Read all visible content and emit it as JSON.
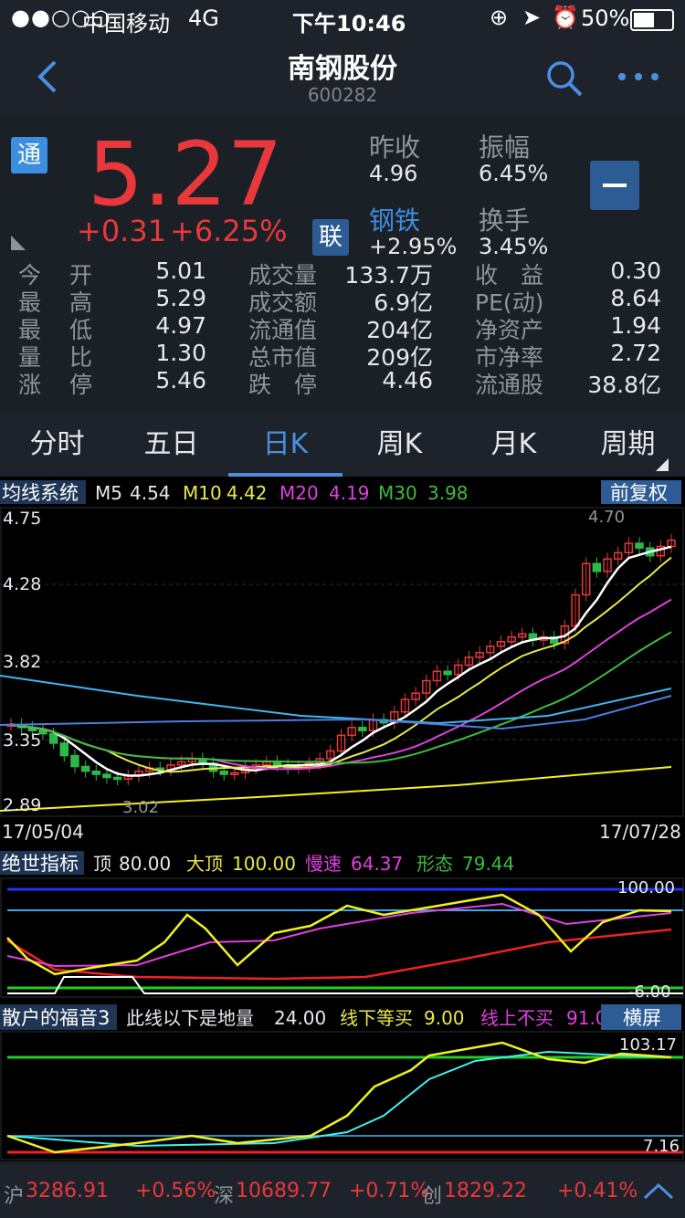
{
  "status": {
    "carrier": "中国移动",
    "network": "4G",
    "time": "下午10:46",
    "battery": "50%"
  },
  "nav": {
    "title": "南钢股份",
    "code": "600282"
  },
  "quote": {
    "tong_badge": "通",
    "lian_badge": "联",
    "price": "5.27",
    "change": "+0.31",
    "change_pct": "+6.25%",
    "prev_close_label": "昨收",
    "prev_close": "4.96",
    "amplitude_label": "振幅",
    "amplitude": "6.45%",
    "sector_label": "钢铁",
    "sector_change": "+2.95%",
    "turnover_label": "换手",
    "turnover": "3.45%",
    "stats": [
      {
        "l1": "今",
        "l2": "开",
        "v1": "5.01",
        "l3": "成交量",
        "v2": "133.7万",
        "l4": "收　益",
        "v3": "0.30"
      },
      {
        "l1": "最",
        "l2": "高",
        "v1": "5.29",
        "l3": "成交额",
        "v2": "6.9亿",
        "l4": "PE(动)",
        "v3": "8.64"
      },
      {
        "l1": "最",
        "l2": "低",
        "v1": "4.97",
        "l3": "流通值",
        "v2": "204亿",
        "l4": "净资产",
        "v3": "1.94"
      },
      {
        "l1": "量",
        "l2": "比",
        "v1": "1.30",
        "l3": "总市值",
        "v2": "209亿",
        "l4": "市净率",
        "v3": "2.72"
      },
      {
        "l1": "涨",
        "l2": "停",
        "v1": "5.46",
        "l3": "跌　停",
        "v2": "4.46",
        "l4": "流通股",
        "v3": "38.8亿"
      }
    ]
  },
  "tabs": [
    "分时",
    "五日",
    "日K",
    "周K",
    "月K",
    "周期"
  ],
  "active_tab": 2,
  "ma": {
    "system": "均线系统",
    "m5_label": "M5",
    "m5": "4.54",
    "m10_label": "M10",
    "m10": "4.42",
    "m20_label": "M20",
    "m20": "4.19",
    "m30_label": "M30",
    "m30": "3.98",
    "fq": "前复权"
  },
  "kline": {
    "y_ticks": [
      "4.75",
      "4.28",
      "3.82",
      "3.35",
      "2.89"
    ],
    "high_label": "4.70",
    "low_label": "3.02",
    "date_start": "17/05/04",
    "date_end": "17/07/28"
  },
  "ind1": {
    "name": "绝世指标",
    "ding_label": "顶",
    "ding": "80.00",
    "dading_label": "大顶",
    "dading": "100.00",
    "mansu_label": "慢速",
    "mansu": "64.37",
    "xingtai_label": "形态",
    "xingtai": "79.44",
    "top": "100.00",
    "bottom": "-6.00"
  },
  "ind2": {
    "name": "散户的福音3",
    "line_below": "此线以下是地量",
    "line_below_v": "24.00",
    "buy_label": "线下等买",
    "buy_v": "9.00",
    "nobuy_label": "线上不买",
    "nobuy_v": "91.0",
    "landscape": "横屏",
    "top": "103.17",
    "bottom": "7.16"
  },
  "footer": {
    "sh_label": "沪",
    "sh": "3286.91",
    "sh_pct": "+0.56%",
    "sz_label": "深",
    "sz": "10689.77",
    "sz_pct": "+0.71%",
    "cy_label": "创",
    "cy": "1829.22",
    "cy_pct": "+0.41%"
  },
  "colors": {
    "up": "#e8383b",
    "down": "#2db84a",
    "accent": "#4a90e2"
  }
}
